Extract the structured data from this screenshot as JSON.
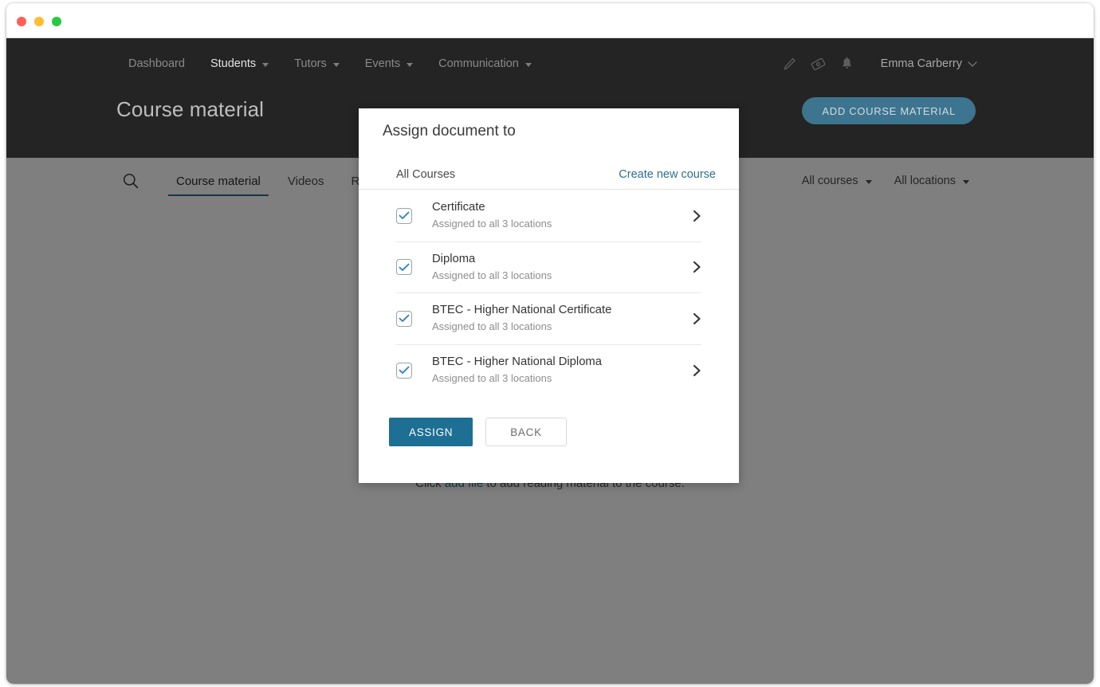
{
  "window": {
    "traffic_lights": [
      {
        "name": "close",
        "color": "#ff5f57"
      },
      {
        "name": "minimize",
        "color": "#febc2e"
      },
      {
        "name": "zoom",
        "color": "#28c840"
      }
    ]
  },
  "header": {
    "nav_items": [
      {
        "label": "Dashboard",
        "has_caret": false,
        "active": false
      },
      {
        "label": "Students",
        "has_caret": true,
        "active": true
      },
      {
        "label": "Tutors",
        "has_caret": true,
        "active": false
      },
      {
        "label": "Events",
        "has_caret": true,
        "active": false
      },
      {
        "label": "Communication",
        "has_caret": true,
        "active": false
      }
    ],
    "icons": [
      {
        "name": "pencil-icon"
      },
      {
        "name": "tag-icon"
      },
      {
        "name": "bell-icon"
      }
    ],
    "user_name": "Emma Carberry",
    "page_title": "Course material",
    "primary_button": "ADD COURSE MATERIAL",
    "primary_button_color": "#3d7490"
  },
  "toolbar": {
    "search_icon": "search-icon",
    "tabs": [
      {
        "label": "Course material",
        "active": true
      },
      {
        "label": "Videos",
        "active": false
      },
      {
        "label": "Recommended reading",
        "active": false
      }
    ],
    "filters": [
      {
        "label": "All courses"
      },
      {
        "label": "All locations"
      }
    ]
  },
  "empty_state": {
    "prefix": "Click ",
    "link": "add file",
    "suffix": " to add reading material to the course."
  },
  "modal": {
    "title": "Assign document to",
    "list_label": "All Courses",
    "create_link": "Create new course",
    "link_color": "#2d6e8e",
    "accent_color": "#1d6f93",
    "rows": [
      {
        "title": "Certificate",
        "subtitle": "Assigned to all 3 locations",
        "checked": true
      },
      {
        "title": "Diploma",
        "subtitle": "Assigned to all 3 locations",
        "checked": true
      },
      {
        "title": "BTEC - Higher National Certificate",
        "subtitle": "Assigned to all 3 locations",
        "checked": true
      },
      {
        "title": "BTEC - Higher National Diploma",
        "subtitle": "Assigned to all 3 locations",
        "checked": true
      }
    ],
    "assign_label": "ASSIGN",
    "back_label": "BACK"
  }
}
